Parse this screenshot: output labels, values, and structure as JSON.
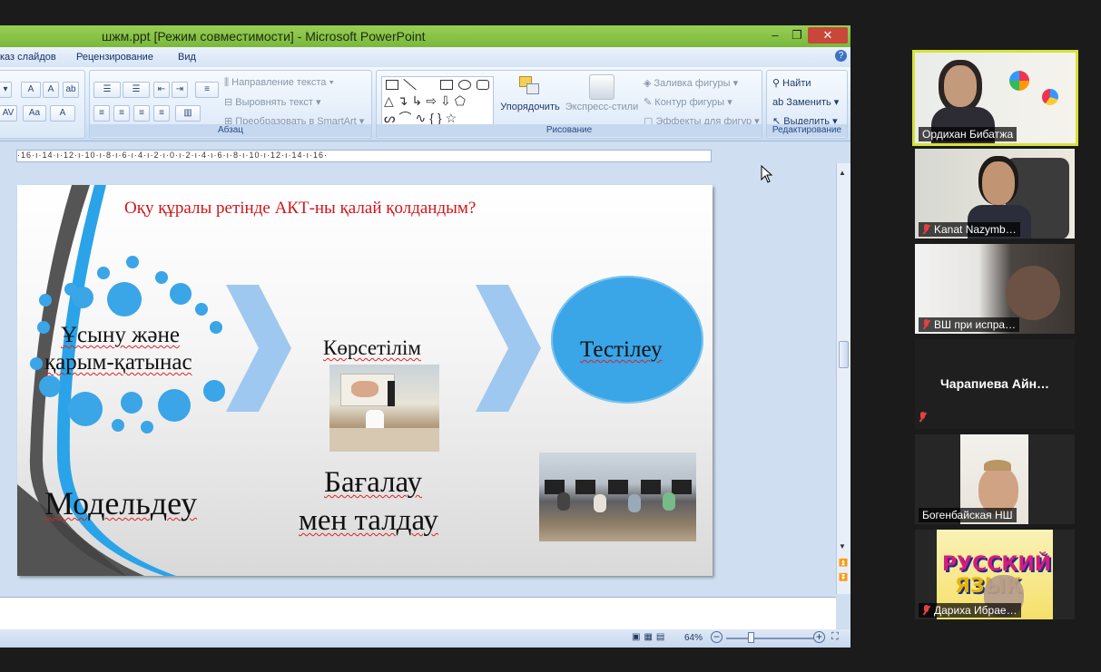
{
  "window": {
    "title": "шжм.ppt [Режим совместимости] - Microsoft PowerPoint",
    "min": "–",
    "restore": "❐",
    "close": "✕"
  },
  "ribbon_tabs": [
    "каз слайдов",
    "Рецензирование",
    "Вид"
  ],
  "ribbon": {
    "paragraph_group": {
      "label": "Абзац",
      "text_direction": "Направление текста",
      "align_text": "Выровнять текст",
      "convert_smartart": "Преобразовать в SmartArt"
    },
    "drawing_group": {
      "label": "Рисование",
      "arrange": "Упорядочить",
      "quick_styles": "Экспресс-стили",
      "shape_fill": "Заливка фигуры",
      "shape_outline": "Контур фигуры",
      "shape_effects": "Эффекты для фигур"
    },
    "editing_group": {
      "label": "Редактирование",
      "find": "Найти",
      "replace": "Заменить",
      "select": "Выделить"
    }
  },
  "ruler_text": "·16·ı·14·ı·12·ı·10·ı·8·ı·6·ı·4·ı·2·ı·0·ı·2·ı·4·ı·6·ı·8·ı·10·ı·12·ı·14·ı·16·",
  "slide": {
    "title": "Оқу құралы ретінде АКТ-ны қалай қолдандым?",
    "item1": "Ұсыну және",
    "item1b": "қарым-қатынас",
    "item2": "Көрсетілім",
    "item3": "Тестілеу",
    "item4": "Модельдеу",
    "item5a": "Бағалау",
    "item5b": "мен талдау"
  },
  "status": {
    "zoom": "64%"
  },
  "participants": [
    {
      "name": "Ордихан Бибатжа",
      "muted": false,
      "active": true
    },
    {
      "name": "Kanat Nazymb…",
      "muted": true
    },
    {
      "name": "ВШ при испра…",
      "muted": true
    },
    {
      "name": "Чарапиева  Айн…",
      "muted": true,
      "no_video": true
    },
    {
      "name": "Богенбайская НШ",
      "muted": false
    },
    {
      "name": "Дариха Ибрае…",
      "muted": true
    }
  ],
  "tile6_overlay": {
    "line1": "РУССКИЙ",
    "line2": "ЯЗЫК"
  },
  "colors": {
    "titlebar": "#7ab83b",
    "slide_accent": "#3aa5e7",
    "slide_title": "#d1151b",
    "active_speaker_border": "#d6e13a"
  }
}
